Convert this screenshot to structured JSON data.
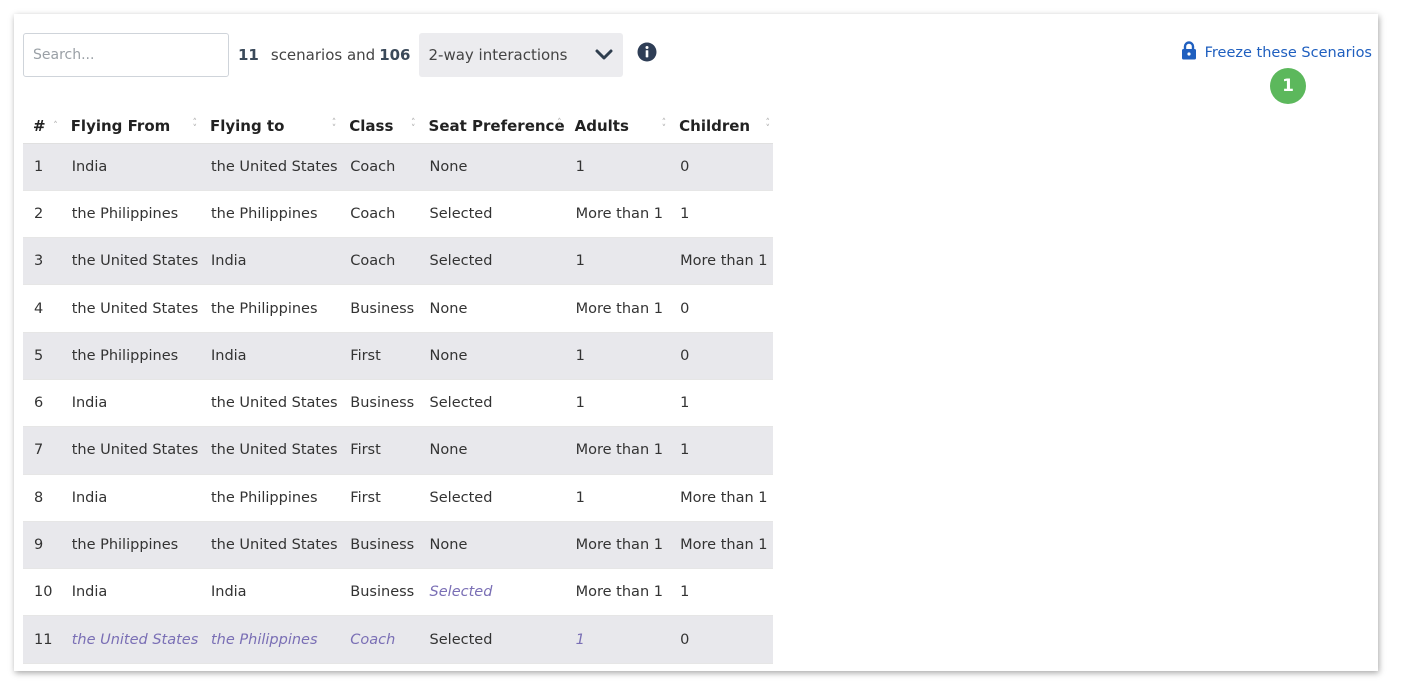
{
  "toolbar": {
    "search_placeholder": "Search...",
    "scenario_count": "11",
    "scenarios_and_text": "scenarios and",
    "interaction_count": "106",
    "interaction_mode": "2-way interactions"
  },
  "freeze": {
    "label": "Freeze these Scenarios",
    "badge": "1"
  },
  "table": {
    "headers": [
      "#",
      "Flying From",
      "Flying to",
      "Class",
      "Seat Preference",
      "Adults",
      "Children"
    ],
    "rows": [
      [
        "1",
        "India",
        "the United States",
        "Coach",
        "None",
        "1",
        "0"
      ],
      [
        "2",
        "the Philippines",
        "the Philippines",
        "Coach",
        "Selected",
        "More than 1",
        "1"
      ],
      [
        "3",
        "the United States",
        "India",
        "Coach",
        "Selected",
        "1",
        "More than 1"
      ],
      [
        "4",
        "the United States",
        "the Philippines",
        "Business",
        "None",
        "More than 1",
        "0"
      ],
      [
        "5",
        "the Philippines",
        "India",
        "First",
        "None",
        "1",
        "0"
      ],
      [
        "6",
        "India",
        "the United States",
        "Business",
        "Selected",
        "1",
        "1"
      ],
      [
        "7",
        "the United States",
        "the United States",
        "First",
        "None",
        "More than 1",
        "1"
      ],
      [
        "8",
        "India",
        "the Philippines",
        "First",
        "Selected",
        "1",
        "More than 1"
      ],
      [
        "9",
        "the Philippines",
        "the United States",
        "Business",
        "None",
        "More than 1",
        "More than 1"
      ],
      [
        "10",
        "India",
        "India",
        "Business",
        "Selected",
        "More than 1",
        "1"
      ],
      [
        "11",
        "the United States",
        "the Philippines",
        "Coach",
        "Selected",
        "1",
        "0"
      ]
    ]
  },
  "colors": {
    "accent_link": "#1f5fbf",
    "badge": "#5cb85c",
    "changed_value": "#7a6fb5",
    "stripe": "#e8e8ec"
  },
  "icons": [
    "info-icon",
    "chevron-down-icon",
    "lock-icon",
    "sort-icon"
  ]
}
